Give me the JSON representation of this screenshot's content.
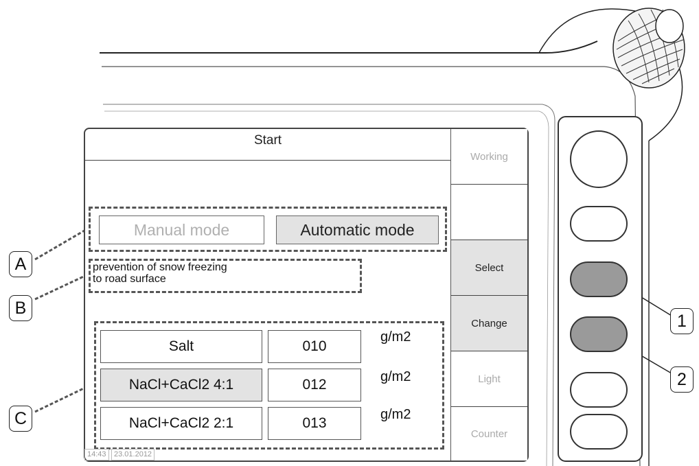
{
  "screen": {
    "title": "Start",
    "mode_buttons": {
      "manual": "Manual mode",
      "automatic": "Automatic mode",
      "selected": "automatic"
    },
    "description": [
      "prevention of snow freezing",
      "to road surface"
    ],
    "materials": [
      {
        "name": "Salt",
        "amount": "010",
        "unit": "g/m2",
        "selected": false
      },
      {
        "name": "NaCl+CaCl2 4:1",
        "amount": "012",
        "unit": "g/m2",
        "selected": true
      },
      {
        "name": "NaCl+CaCl2 2:1",
        "amount": "013",
        "unit": "g/m2",
        "selected": false
      }
    ],
    "status": {
      "time": "14:43",
      "date": "23.01.2012"
    }
  },
  "softkeys": [
    {
      "label": "Working",
      "active": false
    },
    {
      "label": "",
      "active": false
    },
    {
      "label": "Select",
      "active": true
    },
    {
      "label": "Change",
      "active": true
    },
    {
      "label": "Light",
      "active": false
    },
    {
      "label": "Counter",
      "active": false
    }
  ],
  "callouts": {
    "a": "A",
    "b": "B",
    "c": "C",
    "one": "1",
    "two": "2"
  },
  "colors": {
    "active_fill": "#e3e3e3",
    "inactive_text": "#b0b0b0",
    "hw_pressed": "#9a9a9a"
  }
}
